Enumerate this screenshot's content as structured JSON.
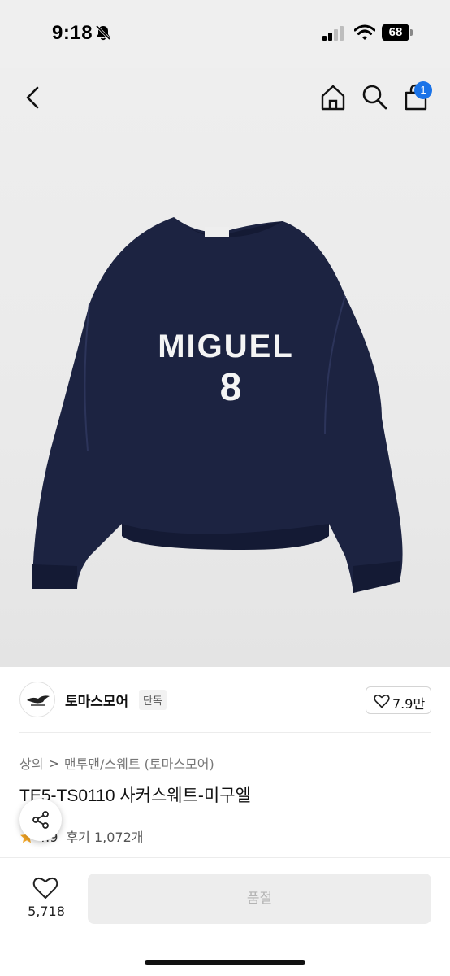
{
  "status_bar": {
    "time": "9:18",
    "battery": "68"
  },
  "nav": {
    "cart_count": "1"
  },
  "product_image": {
    "print_text": "MIGUEL",
    "print_number": "8",
    "garment_color": "#1c2341"
  },
  "brand": {
    "name": "토마스모어",
    "tag": "단독",
    "likes": "7.9만"
  },
  "breadcrumb": {
    "category": "상의",
    "separator": ">",
    "subcategory": "맨투맨/스웨트 (토마스모어)"
  },
  "product": {
    "title": "TE5-TS0110 사커스웨트-미구엘",
    "rating": "4.9",
    "reviews": "후기 1,072개"
  },
  "bottom_bar": {
    "wish_count": "5,718",
    "button_label": "품절"
  },
  "colors": {
    "accent": "#1a73e8",
    "star": "#f5a623"
  }
}
